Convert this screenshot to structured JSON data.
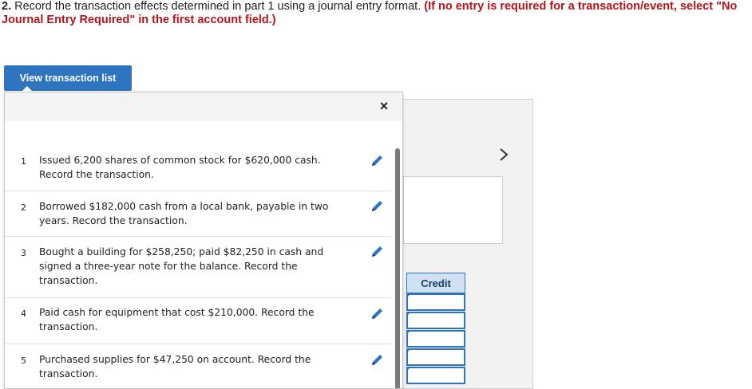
{
  "question": {
    "number": "2.",
    "text": " Record the transaction effects determined in part 1 using a journal entry format. ",
    "note": "(If no entry is required for a transaction/event, select \"No Journal Entry Required\" in the first account field.)"
  },
  "view_button": {
    "label": "View transaction list"
  },
  "popup": {
    "close_icon": "×",
    "transactions": [
      {
        "num": "1",
        "text": "Issued 6,200 shares of common stock for $620,000 cash. Record the transaction."
      },
      {
        "num": "2",
        "text": "Borrowed $182,000 cash from a local bank, payable in two years. Record the transaction."
      },
      {
        "num": "3",
        "text": "Bought a building for $258,250; paid $82,250 in cash and signed a three-year note for the balance. Record the transaction."
      },
      {
        "num": "4",
        "text": "Paid cash for equipment that cost $210,000. Record the transaction."
      },
      {
        "num": "5",
        "text": "Purchased supplies for $47,250 on account. Record the transaction."
      }
    ]
  },
  "journal": {
    "next_arrow": "›",
    "credit_header": "Credit"
  },
  "colors": {
    "accent": "#2f74c0",
    "note_red": "#b3141b"
  }
}
